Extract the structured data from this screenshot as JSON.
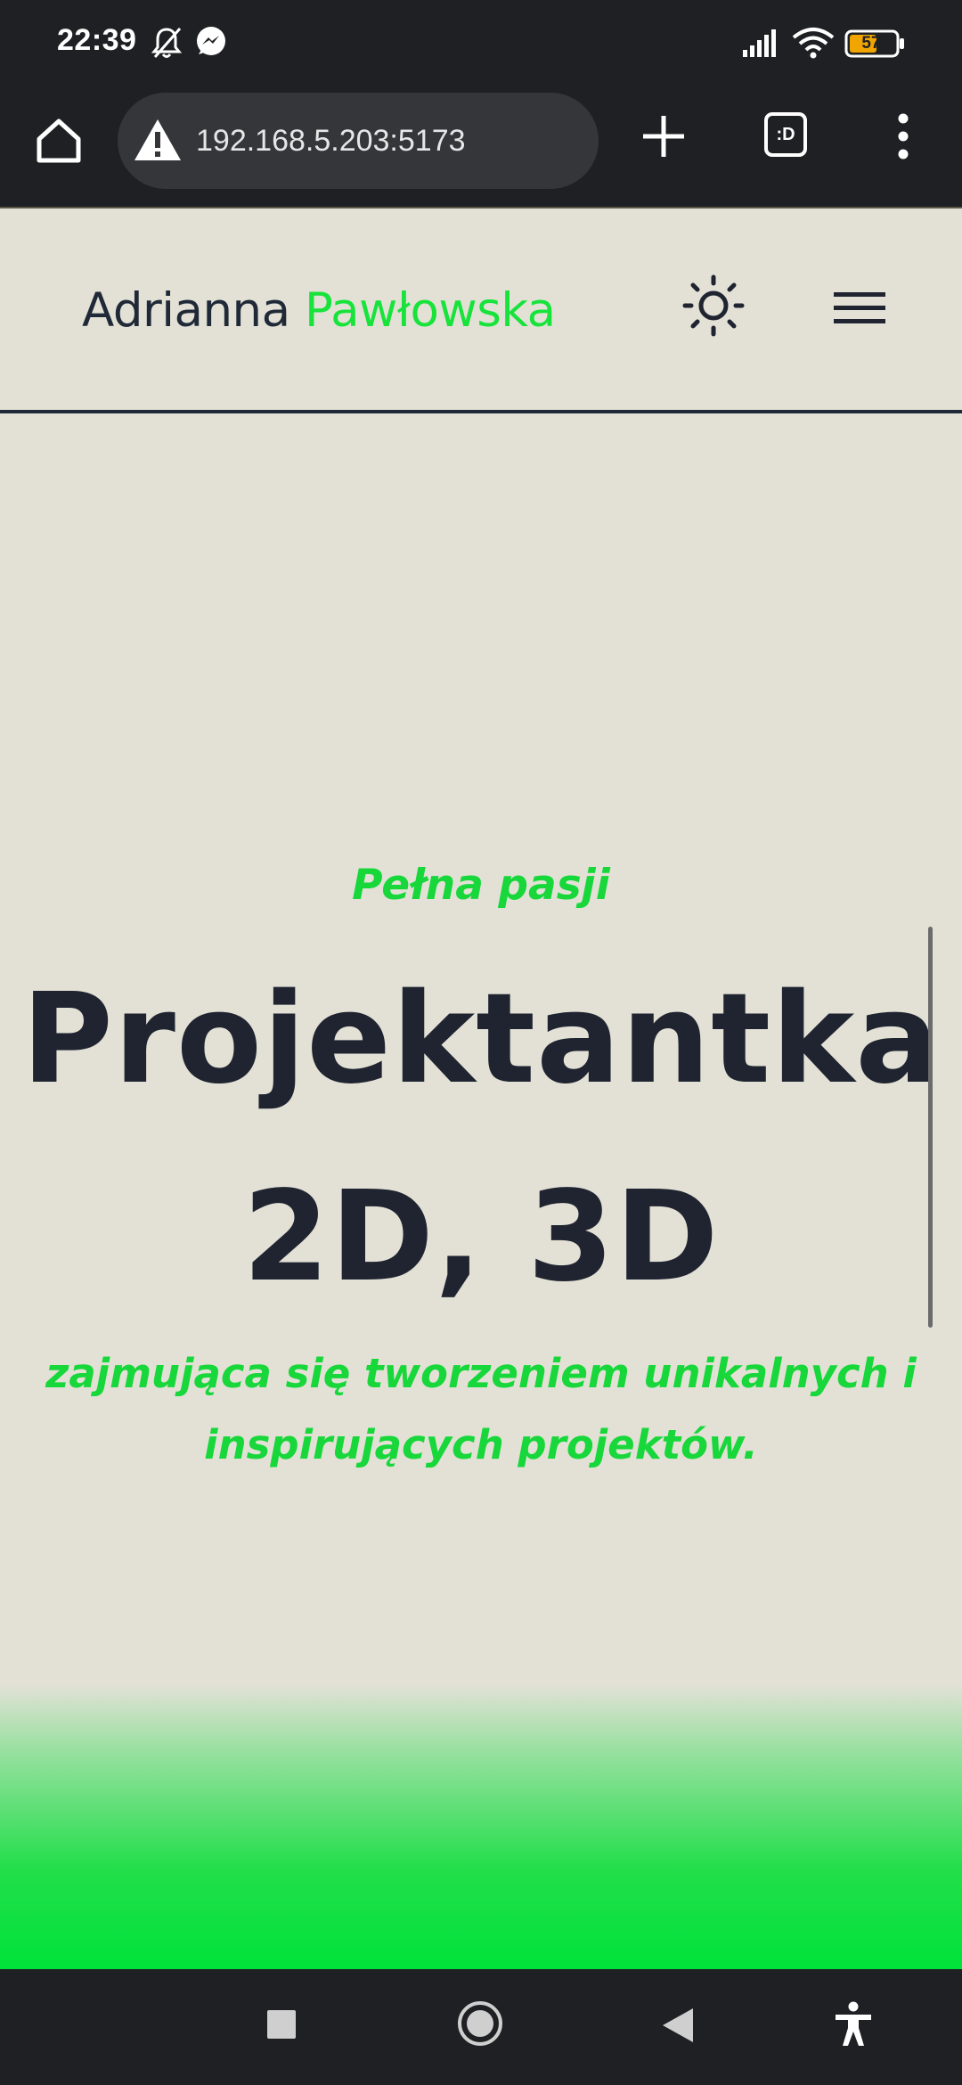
{
  "status_bar": {
    "time": "22:39",
    "battery_level": "57",
    "icons": [
      "bell-off-icon",
      "messenger-icon",
      "signal-icon",
      "wifi-icon",
      "battery-icon"
    ]
  },
  "browser": {
    "url": "192.168.5.203:5173",
    "tabs_label": ":D",
    "icons": [
      "home-icon",
      "warning-icon",
      "plus-icon",
      "more-vert-icon"
    ]
  },
  "site": {
    "brand_first": "Adrianna",
    "brand_last": "Pawłowska",
    "icons": [
      "sun-icon",
      "hamburger-icon"
    ]
  },
  "hero": {
    "kicker": "Pełna pasji",
    "title_line1": "Projektantka",
    "title_line2": "2D, 3D",
    "subtitle": "zajmująca się tworzeniem unikalnych i inspirujących projektów."
  },
  "nav_bar": {
    "icons": [
      "recents-icon",
      "home-circle-icon",
      "back-icon",
      "accessibility-icon"
    ]
  },
  "colors": {
    "page_bg": "#e3e1d6",
    "accent_green": "#17d73a",
    "text_dark": "#1f2430",
    "system_bar": "#1f2023"
  }
}
